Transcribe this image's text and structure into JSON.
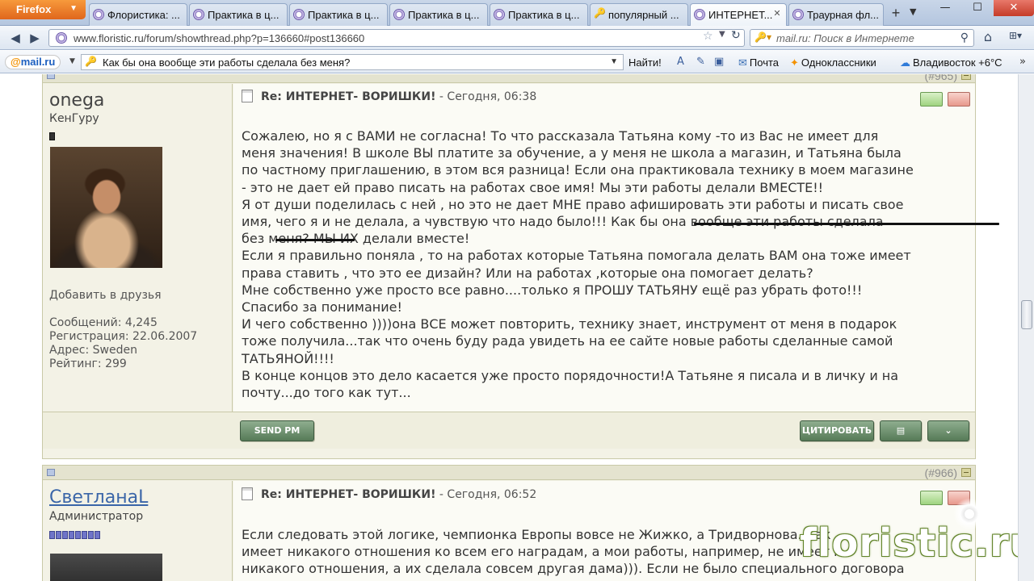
{
  "browser": {
    "firefox_label": "Firefox",
    "tabs": [
      {
        "label": "Флористика: ..."
      },
      {
        "label": "Практика в ц..."
      },
      {
        "label": "Практика в ц..."
      },
      {
        "label": "Практика в ц..."
      },
      {
        "label": "Практика в ц..."
      },
      {
        "label": "популярный ..."
      },
      {
        "label": "ИНТЕРНЕТ..."
      },
      {
        "label": "Траурная фл..."
      }
    ],
    "new_tab": "+",
    "tab_scroll": "▼",
    "window": {
      "min": "—",
      "max": "☐",
      "close": "✕"
    },
    "url": "www.floristic.ru/forum/showthread.php?p=136660#post136660",
    "search_placeholder": "mail.ru: Поиск в Интернете"
  },
  "mailbar": {
    "logo_at": "@",
    "logo_text": "mail.ru",
    "query": "Как бы она вообще эти работы сделала без меня?",
    "find_label": "Найти!",
    "links": {
      "mail": "Почта",
      "ok": "Одноклассники",
      "weather": "Владивосток +6°C"
    }
  },
  "posts": [
    {
      "number": "(#965)",
      "username": "onega",
      "usertitle": "КенГуру",
      "add_friend": "Добавить в друзья",
      "stats": {
        "messages": "Сообщений: 4,245",
        "registered": "Регистрация: 22.06.2007",
        "address": "Адрес: Sweden",
        "rating": "Рейтинг: 299"
      },
      "title": "Re: ИНТЕРНЕТ- ВОРИШКИ!",
      "time": " - Сегодня, 06:38",
      "body": {
        "l1": "Сожалею, но я с ВАМИ не согласна! То что рассказала Татьяна кому -то из Вас не имеет для",
        "l2": "меня значения! В школе ВЫ платите за обучение, а у меня не школа а магазин, и Татьяна была",
        "l3": "по частному приглашению, в этом вся разница! Если она практиковала технику в моем магазине",
        "l4": "- это не дает ей право писать на работах свое имя! Мы эти работы делали ВМЕСТЕ!!",
        "l5": "Я от души поделилась с ней , но это не дает МНЕ право афишировать эти работы и писать свое",
        "l6a": "имя, чего я и не делала, а чувствую что надо было!!! К",
        "l6b": "ак бы она вообще эти работы сделала",
        "l7a": "без меня?",
        "l7b": " МЫ ИХ делали вместе!",
        "l8": "Если я правильно поняла , то на работах которые Татьяна помогала делать ВАМ она тоже имеет",
        "l9": "права ставить , что это ее дизайн? Или на работах ,которые она помогает делать?",
        "l10": "Мне собственно уже просто все равно....только я ПРОШУ ТАТЬЯНУ ещё раз убрать фото!!!",
        "l11": "Спасибо за понимание!",
        "l12": "И чего собственно ))))она ВСЕ может повторить, технику знает, инструмент от меня в подарок",
        "l13": "тоже получила...так что очень буду рада увидеть на ее сайте новые работы сделанные самой",
        "l14": "ТАТЬЯНОЙ!!!!",
        "l15": "В конце концов это дело касается уже просто порядочности!А Татьяне я писала и в личку и на",
        "l16": "почту...до того как тут..."
      },
      "send_pm": "SEND PM",
      "quote": "ЦИТИРОВАТЬ"
    },
    {
      "number": "(#966)",
      "username": "СветланаL",
      "usertitle": "Администратор",
      "title": "Re: ИНТЕРНЕТ- ВОРИШКИ!",
      "time": " - Сегодня, 06:52",
      "body": {
        "l1": "Если следовать этой логике, чемпионка Европы вовсе не Жижко, а Тридворнова. Как",
        "l2": "имеет никакого отношения ко всем его наградам, а мои работы, например, не имеет к",
        "l3": "никакого отношения, а их сделала совсем другая дама))). Если не было специального договора"
      }
    }
  ],
  "watermark": "floristic.ru"
}
